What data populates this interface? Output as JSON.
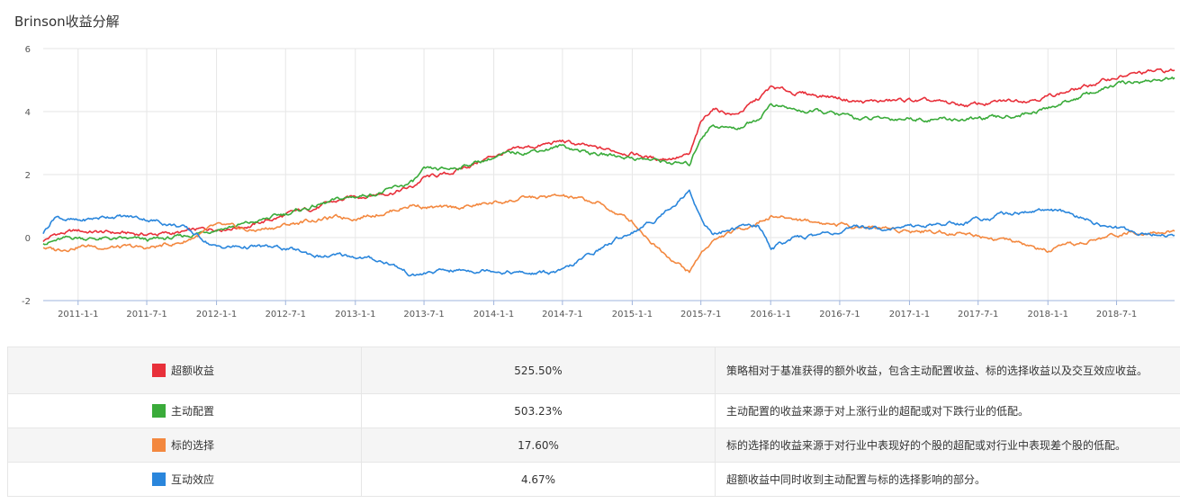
{
  "page": {
    "title": "Brinson收益分解"
  },
  "colors": {
    "excess": "#e8303a",
    "allocation": "#3aab3a",
    "selection": "#f3883f",
    "interaction": "#2a86dc",
    "grid": "#e6e6e6",
    "axis": "#9fb4dc"
  },
  "chart_data": {
    "type": "line",
    "title": "Brinson收益分解",
    "xlabel": "",
    "ylabel": "",
    "x_range": [
      "2010-10-01",
      "2018-12-01"
    ],
    "ylim": [
      -2,
      6
    ],
    "y_ticks": [
      -2,
      0,
      2,
      4,
      6
    ],
    "x_ticks": [
      "2011-1-1",
      "2011-7-1",
      "2012-1-1",
      "2012-7-1",
      "2013-1-1",
      "2013-7-1",
      "2014-1-1",
      "2014-7-1",
      "2015-1-1",
      "2015-7-1",
      "2016-1-1",
      "2016-7-1",
      "2017-1-1",
      "2017-7-1",
      "2018-1-1",
      "2018-7-1"
    ],
    "grid": "vertical",
    "legend": "table-below",
    "series": [
      {
        "name": "超额收益",
        "color": "#e8303a",
        "points": [
          [
            "2010-10-01",
            -0.1
          ],
          [
            "2010-11-01",
            0.1
          ],
          [
            "2011-01-01",
            0.2
          ],
          [
            "2011-04-01",
            0.15
          ],
          [
            "2011-07-01",
            0.1
          ],
          [
            "2011-10-01",
            0.15
          ],
          [
            "2012-01-01",
            0.3
          ],
          [
            "2012-04-01",
            0.4
          ],
          [
            "2012-07-01",
            0.7
          ],
          [
            "2012-10-01",
            1.0
          ],
          [
            "2013-01-01",
            1.3
          ],
          [
            "2013-04-01",
            1.45
          ],
          [
            "2013-06-01",
            1.6
          ],
          [
            "2013-07-01",
            1.9
          ],
          [
            "2013-09-01",
            2.0
          ],
          [
            "2014-01-01",
            2.6
          ],
          [
            "2014-04-01",
            2.85
          ],
          [
            "2014-07-01",
            3.05
          ],
          [
            "2014-10-01",
            2.8
          ],
          [
            "2015-01-01",
            2.7
          ],
          [
            "2015-03-01",
            2.5
          ],
          [
            "2015-06-01",
            2.6
          ],
          [
            "2015-07-01",
            3.6
          ],
          [
            "2015-08-01",
            4.1
          ],
          [
            "2015-10-01",
            3.9
          ],
          [
            "2015-12-01",
            4.4
          ],
          [
            "2016-01-01",
            4.75
          ],
          [
            "2016-03-01",
            4.6
          ],
          [
            "2016-06-01",
            4.5
          ],
          [
            "2016-09-01",
            4.3
          ],
          [
            "2017-01-01",
            4.35
          ],
          [
            "2017-06-01",
            4.2
          ],
          [
            "2017-09-01",
            4.3
          ],
          [
            "2018-01-01",
            4.5
          ],
          [
            "2018-04-01",
            4.75
          ],
          [
            "2018-07-01",
            5.1
          ],
          [
            "2018-10-01",
            5.25
          ],
          [
            "2018-12-01",
            5.3
          ]
        ]
      },
      {
        "name": "主动配置",
        "color": "#3aab3a",
        "points": [
          [
            "2010-10-01",
            -0.15
          ],
          [
            "2010-11-01",
            -0.1
          ],
          [
            "2011-01-01",
            0.0
          ],
          [
            "2011-04-01",
            -0.05
          ],
          [
            "2011-07-01",
            -0.1
          ],
          [
            "2011-10-01",
            0.0
          ],
          [
            "2012-01-01",
            0.3
          ],
          [
            "2012-04-01",
            0.45
          ],
          [
            "2012-07-01",
            0.75
          ],
          [
            "2012-10-01",
            1.05
          ],
          [
            "2013-01-01",
            1.3
          ],
          [
            "2013-04-01",
            1.5
          ],
          [
            "2013-06-01",
            1.75
          ],
          [
            "2013-07-01",
            2.1
          ],
          [
            "2013-09-01",
            2.15
          ],
          [
            "2014-01-01",
            2.55
          ],
          [
            "2014-04-01",
            2.75
          ],
          [
            "2014-07-01",
            2.9
          ],
          [
            "2014-10-01",
            2.65
          ],
          [
            "2015-01-01",
            2.55
          ],
          [
            "2015-03-01",
            2.45
          ],
          [
            "2015-06-01",
            2.3
          ],
          [
            "2015-07-01",
            3.2
          ],
          [
            "2015-08-01",
            3.6
          ],
          [
            "2015-10-01",
            3.45
          ],
          [
            "2015-12-01",
            3.8
          ],
          [
            "2016-01-01",
            4.25
          ],
          [
            "2016-03-01",
            4.05
          ],
          [
            "2016-06-01",
            3.95
          ],
          [
            "2016-09-01",
            3.75
          ],
          [
            "2017-01-01",
            3.8
          ],
          [
            "2017-06-01",
            3.75
          ],
          [
            "2017-09-01",
            3.8
          ],
          [
            "2018-01-01",
            4.1
          ],
          [
            "2018-04-01",
            4.5
          ],
          [
            "2018-07-01",
            4.85
          ],
          [
            "2018-10-01",
            5.0
          ],
          [
            "2018-12-01",
            5.05
          ]
        ]
      },
      {
        "name": "标的选择",
        "color": "#f3883f",
        "points": [
          [
            "2010-10-01",
            -0.3
          ],
          [
            "2010-11-01",
            -0.4
          ],
          [
            "2011-01-01",
            -0.25
          ],
          [
            "2011-04-01",
            -0.3
          ],
          [
            "2011-07-01",
            -0.35
          ],
          [
            "2011-10-01",
            -0.15
          ],
          [
            "2012-01-01",
            0.35
          ],
          [
            "2012-04-01",
            0.2
          ],
          [
            "2012-07-01",
            0.4
          ],
          [
            "2012-10-01",
            0.6
          ],
          [
            "2013-01-01",
            0.65
          ],
          [
            "2013-04-01",
            0.85
          ],
          [
            "2013-06-01",
            1.05
          ],
          [
            "2013-07-01",
            1.0
          ],
          [
            "2013-09-01",
            0.9
          ],
          [
            "2014-01-01",
            1.1
          ],
          [
            "2014-04-01",
            1.25
          ],
          [
            "2014-07-01",
            1.3
          ],
          [
            "2014-10-01",
            1.1
          ],
          [
            "2015-01-01",
            0.5
          ],
          [
            "2015-03-01",
            -0.2
          ],
          [
            "2015-06-01",
            -1.1
          ],
          [
            "2015-07-01",
            -0.5
          ],
          [
            "2015-08-01",
            -0.1
          ],
          [
            "2015-10-01",
            0.2
          ],
          [
            "2015-12-01",
            0.5
          ],
          [
            "2016-01-01",
            0.7
          ],
          [
            "2016-03-01",
            0.6
          ],
          [
            "2016-06-01",
            0.45
          ],
          [
            "2016-09-01",
            0.35
          ],
          [
            "2017-01-01",
            0.25
          ],
          [
            "2017-06-01",
            0.15
          ],
          [
            "2017-09-01",
            -0.05
          ],
          [
            "2018-01-01",
            -0.45
          ],
          [
            "2018-04-01",
            -0.2
          ],
          [
            "2018-07-01",
            0.1
          ],
          [
            "2018-10-01",
            0.25
          ],
          [
            "2018-12-01",
            0.2
          ]
        ]
      },
      {
        "name": "互动效应",
        "color": "#2a86dc",
        "points": [
          [
            "2010-10-01",
            0.15
          ],
          [
            "2010-11-01",
            0.7
          ],
          [
            "2011-01-01",
            0.5
          ],
          [
            "2011-04-01",
            0.7
          ],
          [
            "2011-07-01",
            0.6
          ],
          [
            "2011-10-01",
            0.35
          ],
          [
            "2012-01-01",
            -0.3
          ],
          [
            "2012-04-01",
            -0.3
          ],
          [
            "2012-07-01",
            -0.35
          ],
          [
            "2012-10-01",
            -0.6
          ],
          [
            "2013-01-01",
            -0.6
          ],
          [
            "2013-04-01",
            -0.8
          ],
          [
            "2013-06-01",
            -1.2
          ],
          [
            "2013-07-01",
            -1.15
          ],
          [
            "2013-09-01",
            -1.05
          ],
          [
            "2014-01-01",
            -1.0
          ],
          [
            "2014-04-01",
            -1.15
          ],
          [
            "2014-07-01",
            -1.1
          ],
          [
            "2014-10-01",
            -0.4
          ],
          [
            "2015-01-01",
            0.2
          ],
          [
            "2015-03-01",
            0.55
          ],
          [
            "2015-06-01",
            1.5
          ],
          [
            "2015-07-01",
            0.65
          ],
          [
            "2015-08-01",
            0.1
          ],
          [
            "2015-10-01",
            0.3
          ],
          [
            "2015-12-01",
            0.4
          ],
          [
            "2016-01-01",
            -0.3
          ],
          [
            "2016-03-01",
            -0.05
          ],
          [
            "2016-06-01",
            0.15
          ],
          [
            "2016-09-01",
            0.3
          ],
          [
            "2017-01-01",
            0.35
          ],
          [
            "2017-06-01",
            0.5
          ],
          [
            "2017-09-01",
            0.75
          ],
          [
            "2018-01-01",
            0.9
          ],
          [
            "2018-04-01",
            0.6
          ],
          [
            "2018-07-01",
            0.3
          ],
          [
            "2018-10-01",
            0.1
          ],
          [
            "2018-12-01",
            0.1
          ]
        ]
      }
    ]
  },
  "legend_table": [
    {
      "name": "超额收益",
      "value": "525.50%",
      "description": "策略相对于基准获得的额外收益，包含主动配置收益、标的选择收益以及交互效应收益。",
      "color": "#e8303a"
    },
    {
      "name": "主动配置",
      "value": "503.23%",
      "description": "主动配置的收益来源于对上涨行业的超配或对下跌行业的低配。",
      "color": "#3aab3a"
    },
    {
      "name": "标的选择",
      "value": "17.60%",
      "description": "标的选择的收益来源于对行业中表现好的个股的超配或对行业中表现差个股的低配。",
      "color": "#f3883f"
    },
    {
      "name": "互动效应",
      "value": "4.67%",
      "description": "超额收益中同时收到主动配置与标的选择影响的部分。",
      "color": "#2a86dc"
    }
  ]
}
